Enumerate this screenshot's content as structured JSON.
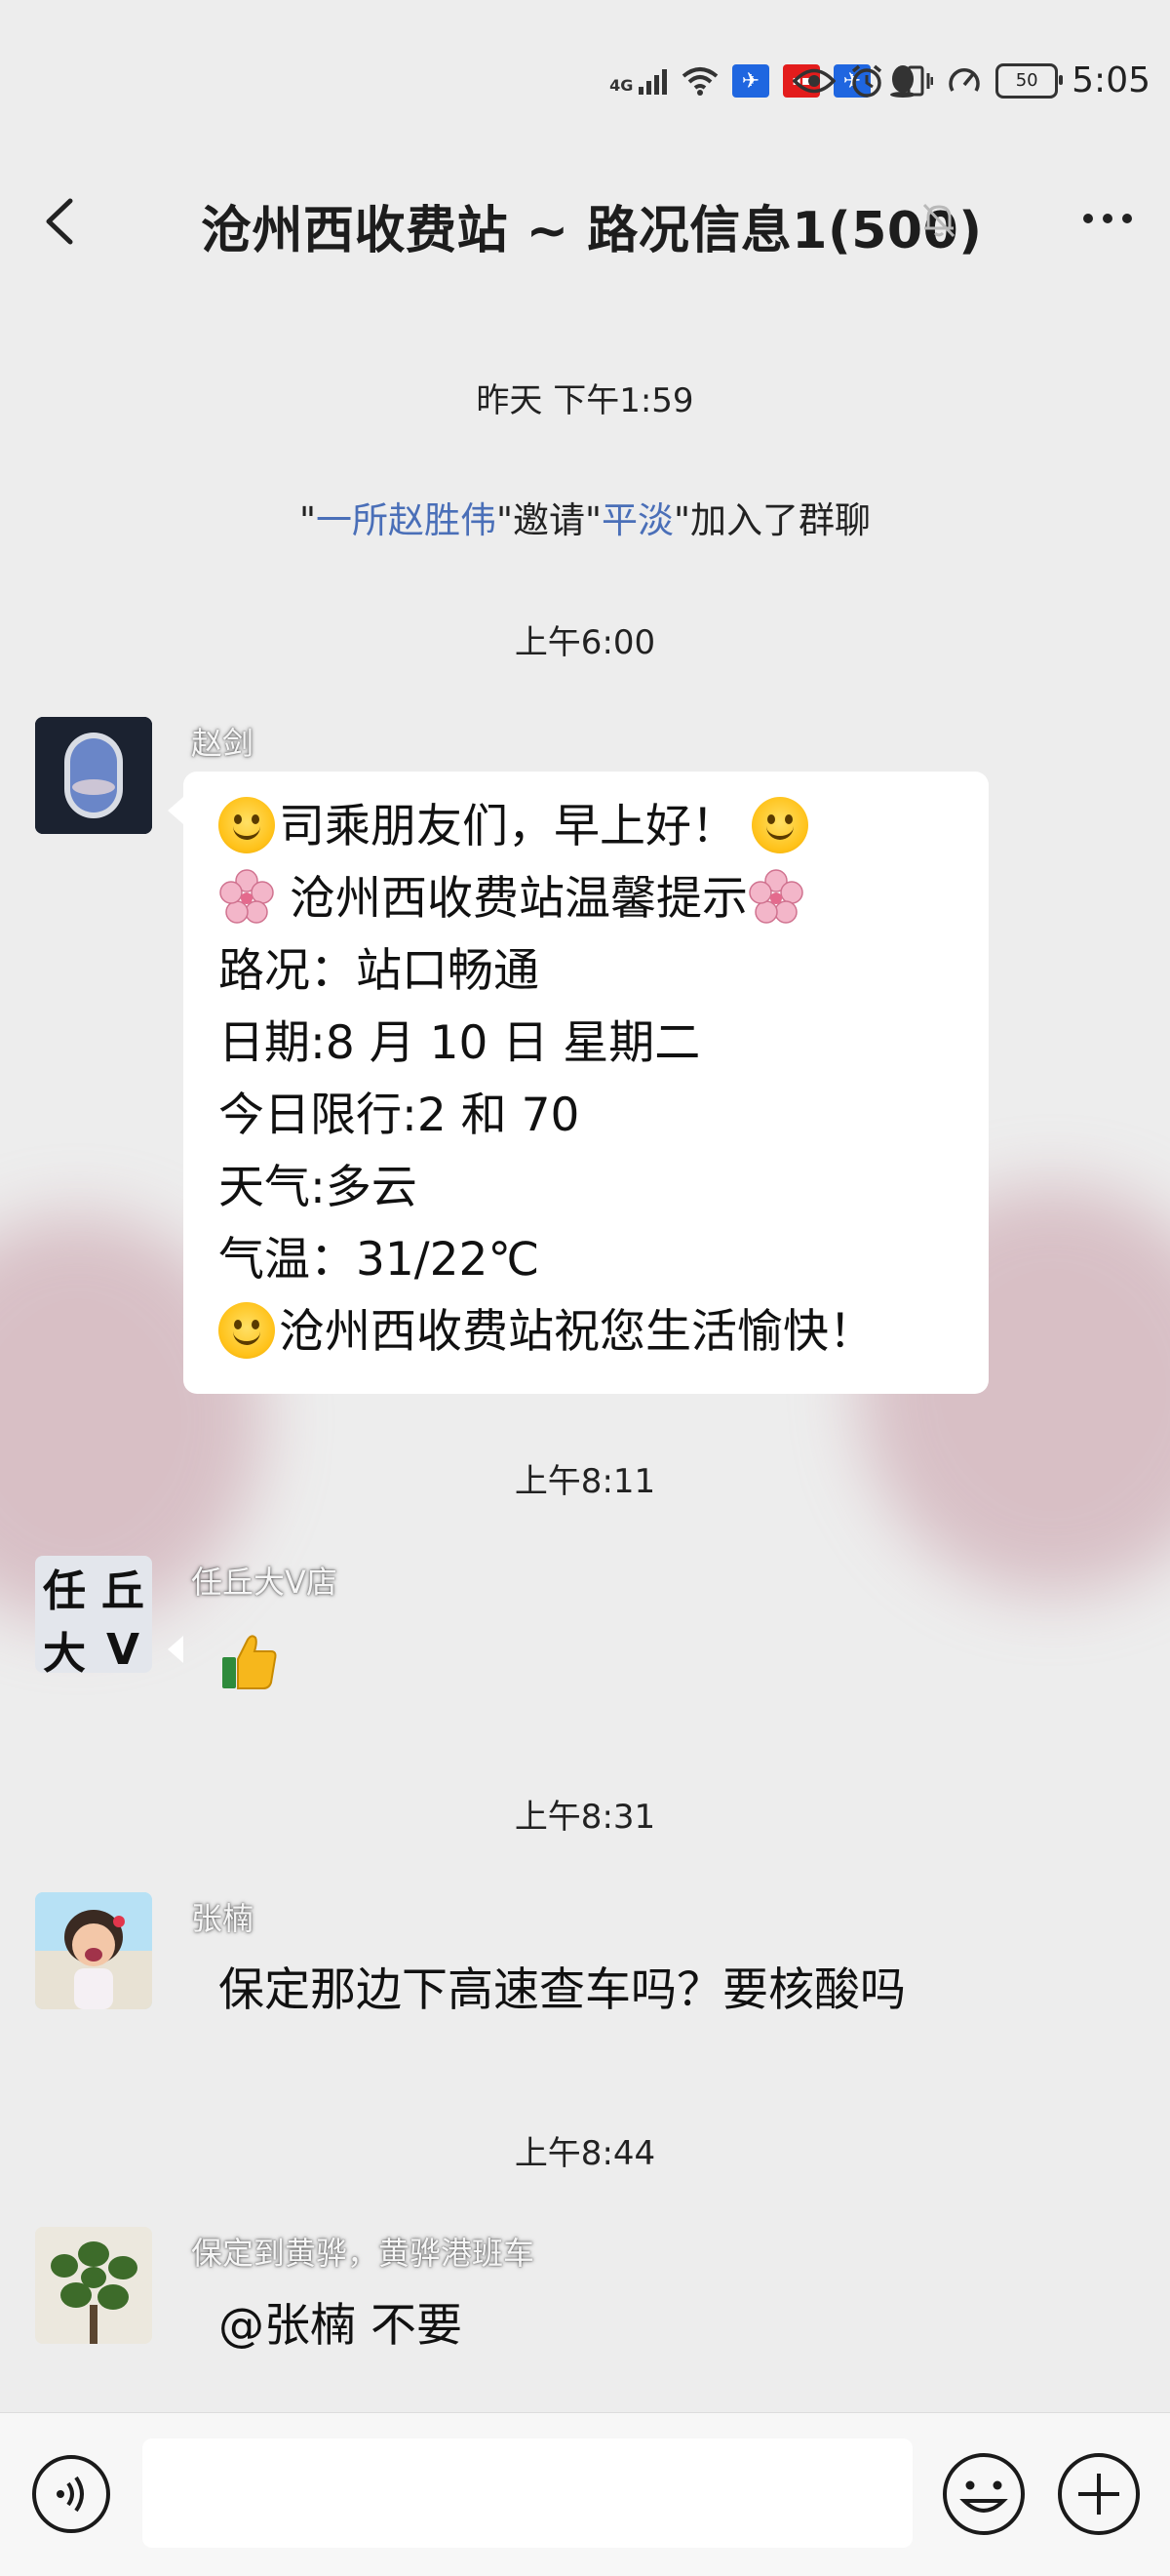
{
  "status_bar": {
    "network": "4G",
    "battery": "50",
    "time": "5:05",
    "app_icons": [
      "wifi-icon",
      "app-icon-1",
      "app-icon-2",
      "app-icon-3",
      "qq-icon"
    ],
    "system_icons": [
      "eye-icon",
      "alarm-icon",
      "vibrate-icon",
      "speed-icon"
    ]
  },
  "header": {
    "title": "沧州西收费站 ~ 路况信息1(500)"
  },
  "chat": {
    "divider_1": "昨天 下午1:59",
    "system_message": {
      "prefix": "\"",
      "inviter": "一所赵胜伟",
      "middle": "\"邀请\"",
      "invitee": "平淡",
      "suffix": "\"加入了群聊"
    },
    "divider_2": "上午6:00",
    "messages": [
      {
        "sender": "赵剑",
        "lines": [
          "司乘朋友们，早上好！",
          " 沧州西收费站温馨提示",
          "路况：站口畅通",
          "日期:8 月 10 日 星期二",
          "今日限行:2 和 70",
          "天气:多云",
          "气温：31/22℃",
          "沧州西收费站祝您生活愉快！"
        ]
      },
      {
        "sender": "任丘大V店",
        "avatar_text": [
          "任",
          "丘",
          "大",
          "V"
        ],
        "content": "thumbs-up"
      },
      {
        "sender": "张楠",
        "text": "保定那边下高速查车吗？要核酸吗"
      },
      {
        "sender": "保定到黄骅，黄骅港班车",
        "text": "@张楠  不要"
      }
    ],
    "divider_3": "上午8:11",
    "divider_4": "上午8:31",
    "divider_5": "上午8:44"
  },
  "input_bar": {
    "text_value": ""
  }
}
